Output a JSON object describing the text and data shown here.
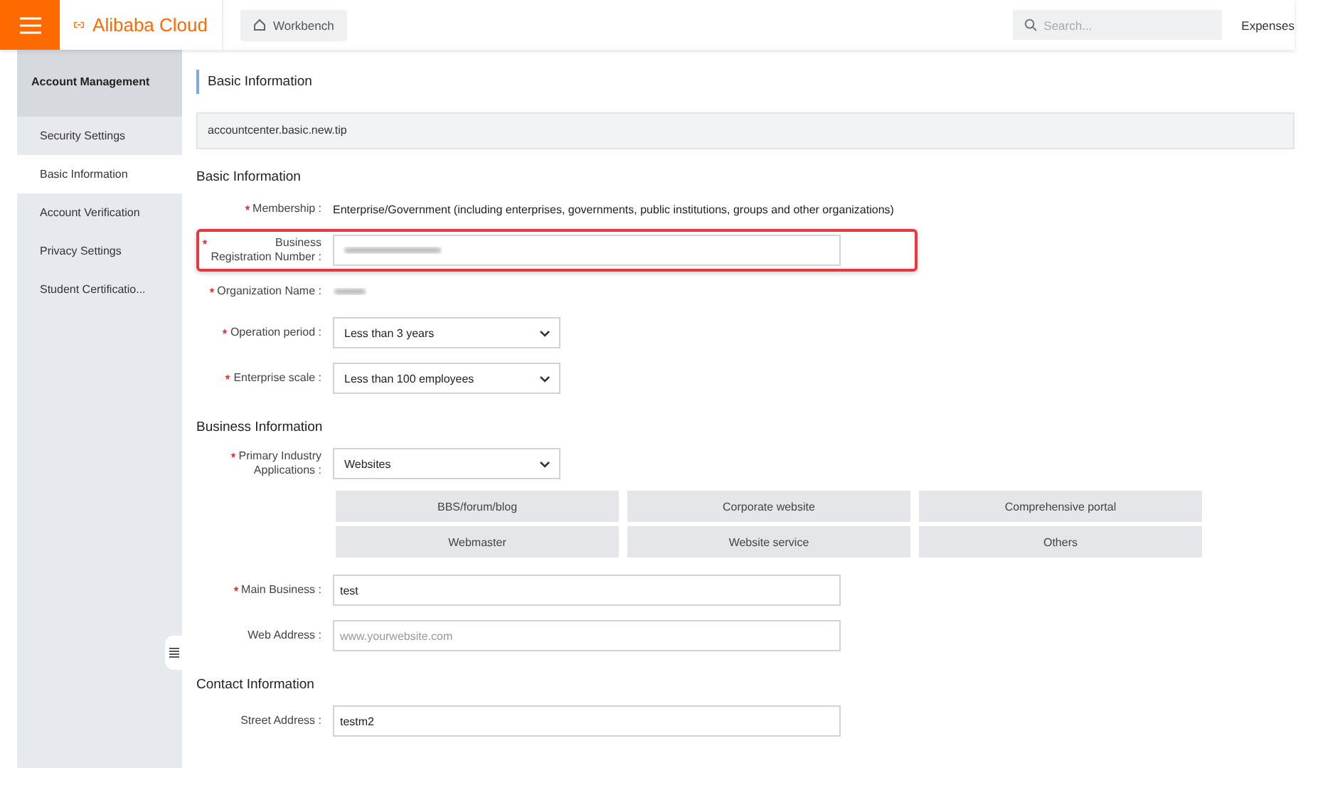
{
  "topbar": {
    "brand": "Alibaba Cloud",
    "workbench": "Workbench",
    "search": {
      "placeholder": "Search..."
    },
    "expenses": "Expenses"
  },
  "sidebar": {
    "title": "Account Management",
    "items": [
      {
        "label": "Security Settings",
        "selected": false
      },
      {
        "label": "Basic Information",
        "selected": true
      },
      {
        "label": "Account Verification",
        "selected": false
      },
      {
        "label": "Privacy Settings",
        "selected": false
      },
      {
        "label": "Student Certificatio...",
        "selected": false
      }
    ]
  },
  "page_title": "Basic Information",
  "tip": "accountcenter.basic.new.tip",
  "sections": [
    {
      "title": "Basic Information",
      "fields": [
        {
          "kind": "text",
          "label": "Membership :",
          "required": true,
          "value": "Enterprise/Government (including enterprises, governments, public institutions, groups and other organizations)"
        },
        {
          "kind": "redacted-input",
          "label": "Business\nRegistration Number :",
          "required": true,
          "highlighted": true
        },
        {
          "kind": "redacted-text",
          "label": "Organization Name :",
          "required": true
        },
        {
          "kind": "select",
          "label": "Operation period :",
          "required": true,
          "value": "Less than 3 years"
        },
        {
          "kind": "select",
          "label": "Enterprise scale :",
          "required": true,
          "value": "Less than 100 employees"
        }
      ]
    },
    {
      "title": "Business Information",
      "fields": [
        {
          "kind": "select",
          "label": "Primary Industry\nApplications :",
          "required": true,
          "value": "Websites"
        },
        {
          "kind": "options",
          "options": [
            "BBS/forum/blog",
            "Corporate website",
            "Comprehensive portal",
            "Webmaster",
            "Website service",
            "Others"
          ]
        },
        {
          "kind": "input",
          "label": "Main Business :",
          "required": true,
          "value": "test"
        },
        {
          "kind": "input",
          "label": "Web Address :",
          "required": false,
          "placeholder": "www.yourwebsite.com"
        }
      ]
    },
    {
      "title": "Contact Information",
      "fields": [
        {
          "kind": "input",
          "label": "Street Address :",
          "required": false,
          "value": "testm2"
        }
      ]
    }
  ]
}
